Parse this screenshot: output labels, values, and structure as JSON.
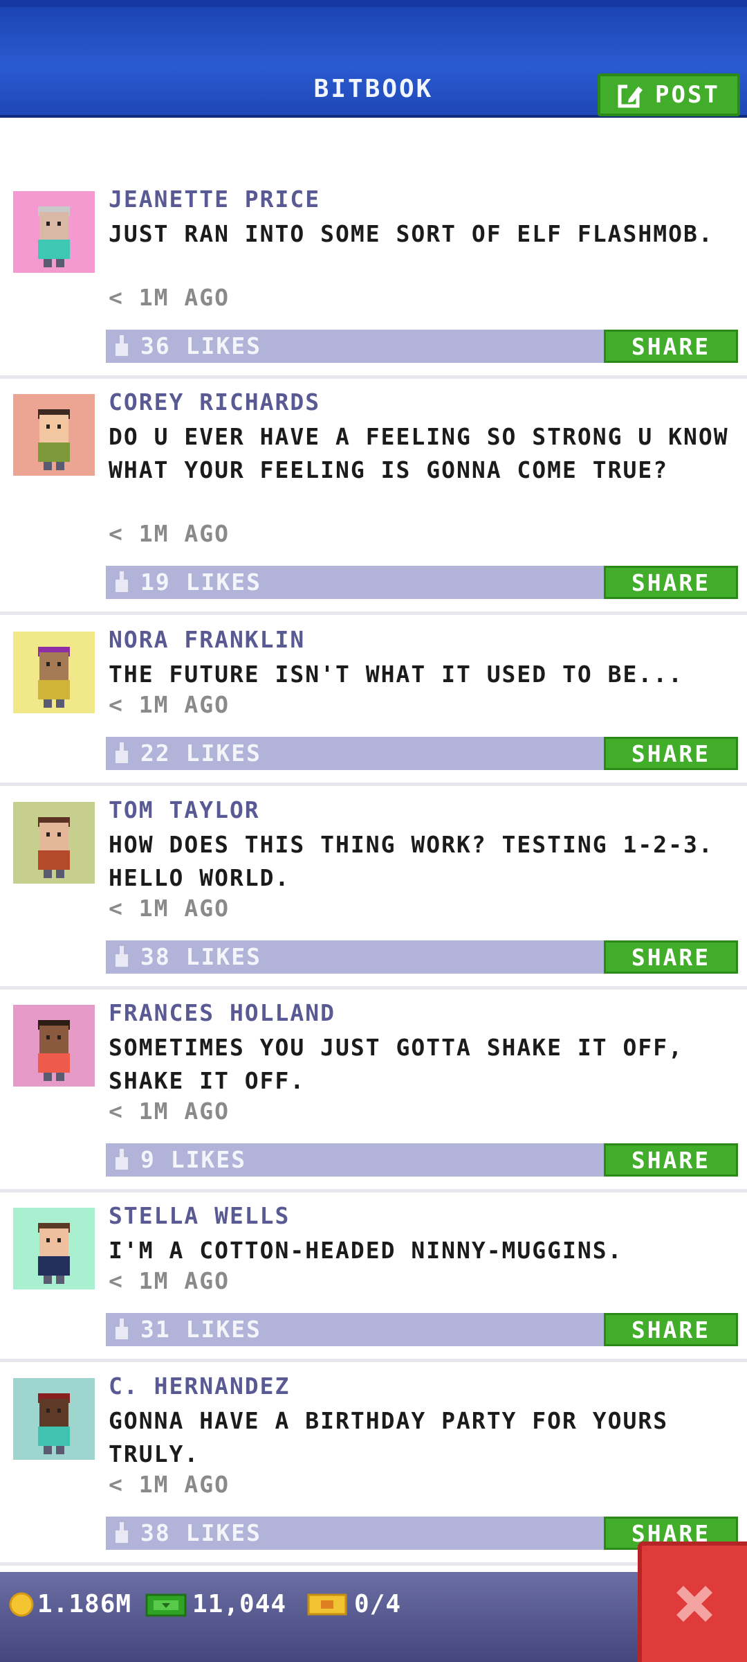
{
  "header": {
    "title": "BITBOOK",
    "post_label": "POST"
  },
  "posts": [
    {
      "name": "JEANETTE PRICE",
      "message": "JUST RAN INTO SOME SORT OF ELF FLASHMOB.",
      "time": "< 1M AGO",
      "likes": "36 LIKES",
      "share": "SHARE",
      "avatar_bg": "#f49ad0",
      "skin": "#d9b8a8",
      "hair": "#c9c9c9",
      "shirt": "#3ec8b4"
    },
    {
      "name": "COREY RICHARDS",
      "message": "DO U EVER HAVE A FEELING SO STRONG U KNOW WHAT YOUR FEELING IS GONNA COME TRUE?",
      "time": "< 1M AGO",
      "likes": "19 LIKES",
      "share": "SHARE",
      "avatar_bg": "#eda593",
      "skin": "#f2c6a0",
      "hair": "#3b2a22",
      "shirt": "#7c9a3a"
    },
    {
      "name": "NORA FRANKLIN",
      "message": "THE FUTURE ISN'T WHAT IT USED TO BE...",
      "time": "< 1M AGO",
      "likes": "22 LIKES",
      "share": "SHARE",
      "avatar_bg": "#f1e88a",
      "skin": "#a67a55",
      "hair": "#8e2ea5",
      "shirt": "#d0b43a"
    },
    {
      "name": "TOM TAYLOR",
      "message": "HOW DOES THIS THING WORK? TESTING 1-2-3. HELLO WORLD.",
      "time": "< 1M AGO",
      "likes": "38 LIKES",
      "share": "SHARE",
      "avatar_bg": "#c7cf8e",
      "skin": "#e5b79a",
      "hair": "#5a3322",
      "shirt": "#b54a2a"
    },
    {
      "name": "FRANCES HOLLAND",
      "message": "SOMETIMES YOU JUST GOTTA SHAKE IT OFF, SHAKE IT OFF.",
      "time": "< 1M AGO",
      "likes": "9 LIKES",
      "share": "SHARE",
      "avatar_bg": "#e59ac8",
      "skin": "#8a5a3e",
      "hair": "#2b1c14",
      "shirt": "#ef5b4a"
    },
    {
      "name": "STELLA WELLS",
      "message": "I'M A COTTON-HEADED NINNY-MUGGINS.",
      "time": "< 1M AGO",
      "likes": "31 LIKES",
      "share": "SHARE",
      "avatar_bg": "#a8f0d0",
      "skin": "#efc0a0",
      "hair": "#5b3a26",
      "shirt": "#23305e"
    },
    {
      "name": "C. HERNANDEZ",
      "message": "GONNA HAVE A BIRTHDAY PARTY FOR YOURS TRULY.",
      "time": "< 1M AGO",
      "likes": "38 LIKES",
      "share": "SHARE",
      "avatar_bg": "#9ed6cf",
      "skin": "#5e3a28",
      "hair": "#8a1f1f",
      "shirt": "#3fc2b0"
    }
  ],
  "status_bar": {
    "coins": "1.186M",
    "bux": "11,044",
    "tickets": "0/4"
  },
  "colors": {
    "header_blue": "#2a5bd0",
    "accent_green": "#42ad2a",
    "like_bar": "#b1b3d8",
    "name_purple": "#595a93",
    "close_red": "#e03b3b"
  }
}
